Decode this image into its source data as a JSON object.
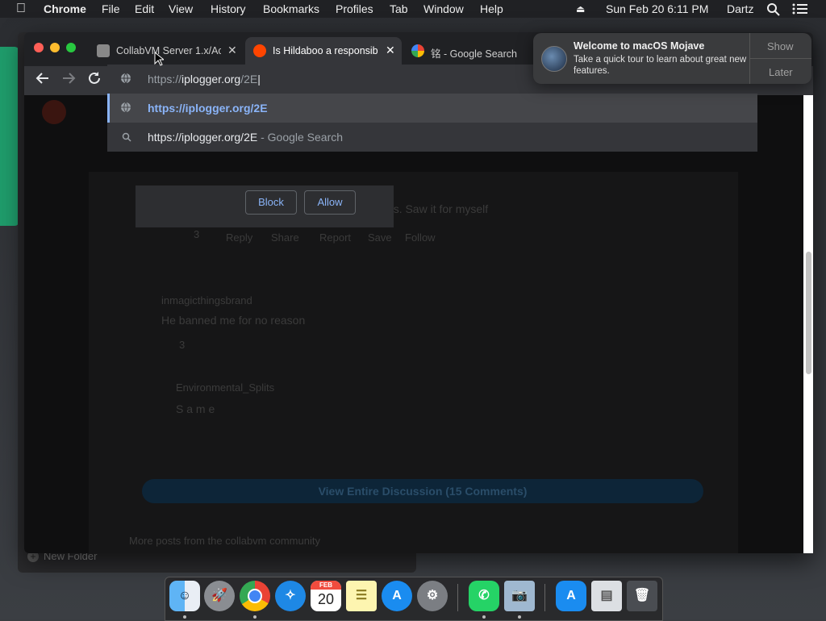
{
  "menubar": {
    "app": "Chrome",
    "items": [
      "File",
      "Edit",
      "View",
      "History",
      "Bookmarks",
      "Profiles",
      "Tab",
      "Window",
      "Help"
    ],
    "clock": "Sun Feb 20  6:11 PM",
    "user": "Dartz"
  },
  "tabs": [
    {
      "title": "CollabVM Server 1.x/Ac"
    },
    {
      "title": "Is Hildaboo a responsib"
    },
    {
      "title": "铭 - Google Search"
    }
  ],
  "omnibox": {
    "typed_prefix": "https://",
    "typed_domain": "iplogger.org",
    "typed_path": "/2E",
    "suggestion_url": "https://iplogger.org/2E",
    "search_query": "https://iplogger.org/2E",
    "search_suffix": " - Google Search"
  },
  "permission": {
    "block": "Block",
    "allow": "Allow"
  },
  "notification": {
    "title": "Welcome to macOS Mojave",
    "body": "Take a quick tour to learn about great new features.",
    "show": "Show",
    "later": "Later"
  },
  "page": {
    "comment1_text": "He also uses kitting tools to fuck up the VMs. Saw it for myself",
    "comment1_votes": "3",
    "comment2_user": "inmagicthingsbrand",
    "comment2_text": "He banned me for no reason",
    "comment2_votes": "3",
    "comment3_user": "Environmental_Splits",
    "comment3_text": "S a m e",
    "action_reply": "Reply",
    "action_share": "Share",
    "action_report": "Report",
    "action_save": "Save",
    "action_follow": "Follow",
    "view_discussion": "View Entire Discussion (15 Comments)",
    "more_posts": "More posts from the collabvm community"
  },
  "finder": {
    "new_folder": "New Folder"
  },
  "dock": {
    "calendar_month": "FEB",
    "calendar_day": "20"
  },
  "colors": {
    "accent": "#8ab4f8",
    "suggestion_highlight": "#8ab4f8"
  }
}
